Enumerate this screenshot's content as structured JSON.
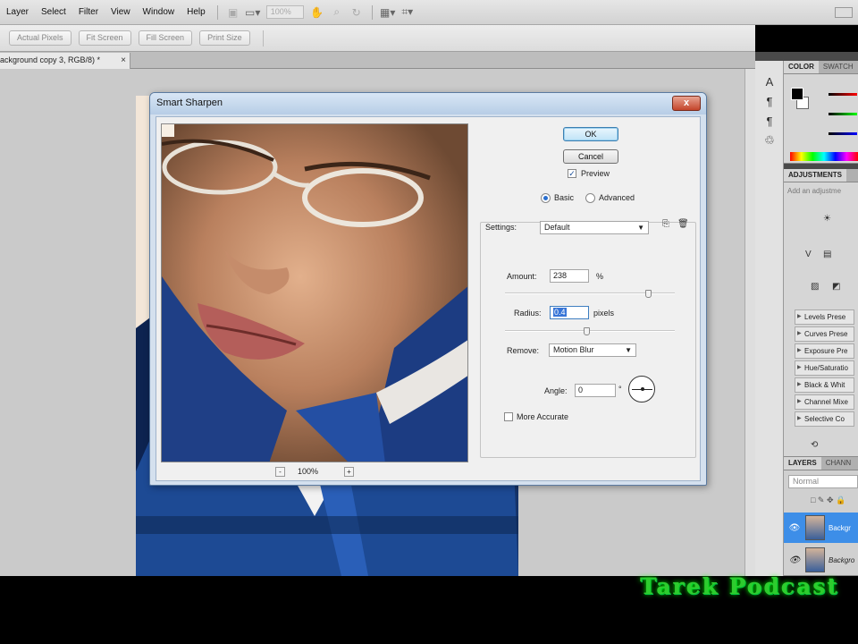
{
  "menubar": {
    "items": [
      "Layer",
      "Select",
      "Filter",
      "View",
      "Window",
      "Help"
    ],
    "zoom_value": "100%"
  },
  "options_bar": {
    "buttons": [
      "Actual Pixels",
      "Fit Screen",
      "Fill Screen",
      "Print Size"
    ]
  },
  "document_tab": {
    "label": "ackground copy 3, RGB/8) *",
    "close": "×"
  },
  "panels": {
    "color_tabs": [
      "COLOR",
      "SWATCH"
    ],
    "adjustments_title": "ADJUSTMENTS",
    "adjustments_hint": "Add an adjustme",
    "presets": [
      "Levels Prese",
      "Curves Prese",
      "Exposure Pre",
      "Hue/Saturatio",
      "Black & Whit",
      "Channel Mixe",
      "Selective Co"
    ],
    "layers_tabs": [
      "LAYERS",
      "CHANN"
    ],
    "blend_mode": "Normal",
    "layers": [
      "Backgr",
      "Backgro"
    ]
  },
  "dialog": {
    "title": "Smart Sharpen",
    "close_label": "x",
    "ok_label": "OK",
    "cancel_label": "Cancel",
    "preview_label": "Preview",
    "preview_checked": true,
    "mode_basic": "Basic",
    "mode_advanced": "Advanced",
    "mode_selected": "Basic",
    "settings_label": "Settings:",
    "settings_value": "Default",
    "amount_label": "Amount:",
    "amount_value": "238",
    "amount_unit": "%",
    "amount_slider": 0.48,
    "radius_label": "Radius:",
    "radius_value": "0.4",
    "radius_unit": "pixels",
    "radius_slider": 0.02,
    "remove_label": "Remove:",
    "remove_value": "Motion Blur",
    "angle_label": "Angle:",
    "angle_value": "0",
    "angle_unit": "°",
    "more_accurate_label": "More Accurate",
    "more_accurate_checked": false,
    "preview_zoom": "100%",
    "zoom_minus": "-",
    "zoom_plus": "+"
  },
  "watermark": "Tarek Podcast"
}
